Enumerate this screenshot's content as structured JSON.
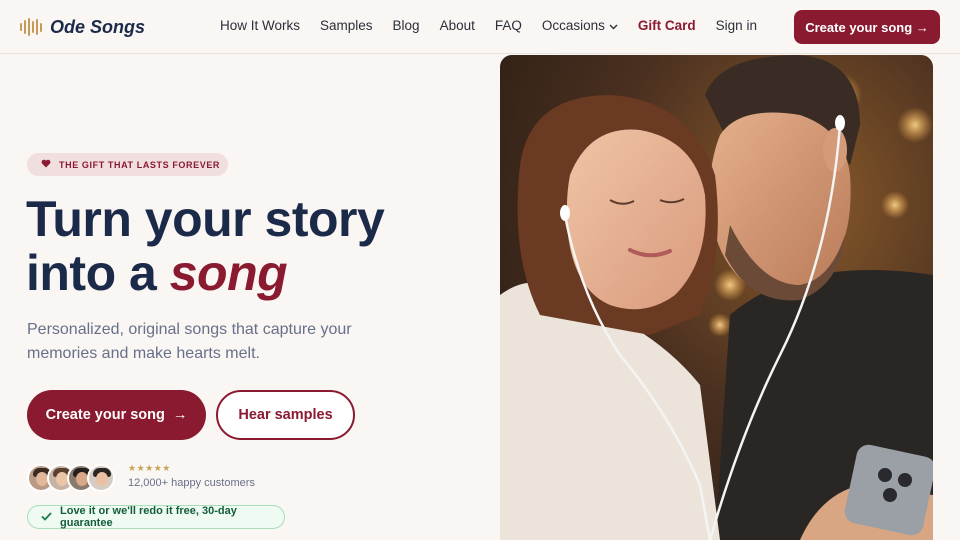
{
  "brand": {
    "name": "Ode Songs",
    "logo_icon": "soundwave-icon"
  },
  "nav": {
    "items": [
      {
        "label": "How It Works"
      },
      {
        "label": "Samples"
      },
      {
        "label": "Blog"
      },
      {
        "label": "About"
      },
      {
        "label": "FAQ"
      },
      {
        "label": "Occasions"
      },
      {
        "label": "Gift Card"
      },
      {
        "label": "Sign in"
      }
    ],
    "cta": "Create your song →"
  },
  "hero": {
    "badge": "THE GIFT THAT LASTS FOREVER",
    "headline_line1": "Turn your story",
    "headline_line2_prefix": "into a ",
    "headline_accent": "song",
    "subtext": "Personalized, original songs that capture your memories and make hearts melt.",
    "primary_cta": "Create your song",
    "primary_cta_arrow": "→",
    "secondary_cta": "Hear samples",
    "rating_stars": "★★★★★",
    "customers": "12,000+ happy customers",
    "guarantee": "Love it or we'll redo it free, 30-day guarantee"
  },
  "colors": {
    "brand": "#8a1a30",
    "navy": "#1c2a4a",
    "background": "#faf6f3",
    "gold": "#c9a356"
  }
}
